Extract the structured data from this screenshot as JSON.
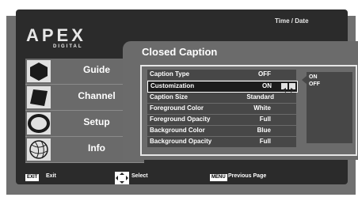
{
  "brand": {
    "logo": "APEX",
    "sub": "DIGITAL"
  },
  "header": {
    "time_label": "Time / Date"
  },
  "nav": [
    {
      "label": "Guide",
      "icon": "hexagon-icon"
    },
    {
      "label": "Channel",
      "icon": "parallelogram-icon"
    },
    {
      "label": "Setup",
      "icon": "ellipse-icon"
    },
    {
      "label": "Info",
      "icon": "globe-icon"
    }
  ],
  "panel": {
    "title": "Closed Caption",
    "rows": [
      {
        "label": "Caption Type",
        "value": "OFF"
      },
      {
        "label": "Customization",
        "value": "ON"
      },
      {
        "label": "Caption Size",
        "value": "Standard"
      },
      {
        "label": "Foreground Color",
        "value": "White"
      },
      {
        "label": "Foreground Opacity",
        "value": "Full"
      },
      {
        "label": "Background Color",
        "value": "Blue"
      },
      {
        "label": "Background Opacity",
        "value": "Full"
      }
    ],
    "options": [
      "ON",
      "OFF"
    ]
  },
  "footer": {
    "exit_key": "EXIT",
    "exit_label": "Exit",
    "select_label": "Select",
    "menu_key": "MENU",
    "menu_label": "Previous Page"
  },
  "colors": {
    "bezel": "#707070",
    "screen": "#2b2b2b",
    "panel": "#6b6b6b",
    "row": "#474747",
    "selected_row": "#1c1c1c"
  }
}
